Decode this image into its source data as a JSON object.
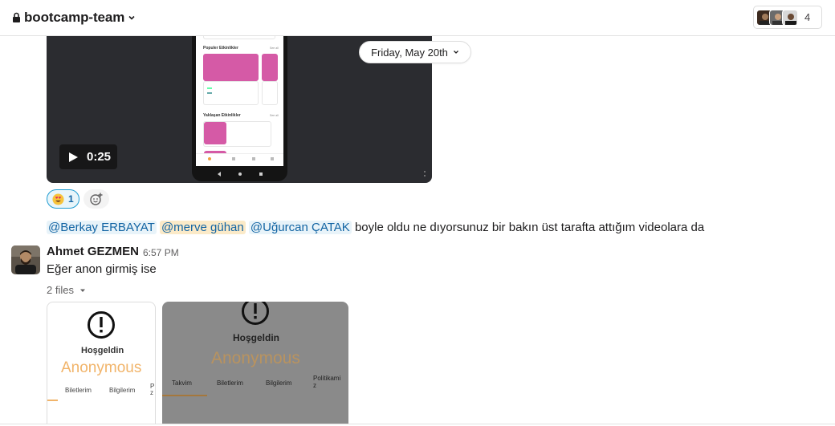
{
  "header": {
    "channel_name": "bootcamp-team",
    "member_count": "4"
  },
  "date_divider": {
    "label": "Friday, May 20th"
  },
  "video": {
    "duration": "0:25",
    "phone_screen": {
      "section1": "Populer Etkinlikler",
      "section1_link": "See all",
      "section2": "Yaklaşan Etkinlikler",
      "section2_link": "See all"
    }
  },
  "reactions": [
    {
      "emoji": "heart-eyes",
      "count": "1"
    }
  ],
  "message1": {
    "mentions": [
      "@Berkay ERBAYAT",
      "@merve gühan",
      "@Uğurcan ÇATAK"
    ],
    "text": "boyle oldu ne dıyorsunuz bir bakın üst tarafta attığım videolara da"
  },
  "message2": {
    "author": "Ahmet GEZMEN",
    "time": "6:57 PM",
    "text": "Eğer anon girmiş ise",
    "files_label": "2 files"
  },
  "attachment1": {
    "greeting": "Hoşgeldin",
    "name": "Anonymous",
    "tabs": [
      "Biletlerim",
      "Bilgilerim",
      "P z"
    ]
  },
  "attachment2": {
    "greeting": "Hoşgeldin",
    "name": "Anonymous",
    "tabs": [
      "Takvim",
      "Biletlerim",
      "Bilgilerim",
      "Politikami z"
    ]
  },
  "colors": {
    "mention_text": "#1264a3",
    "mention_bg": "#e8f3f9",
    "self_mention_bg": "#fbeac8",
    "anon_orange": "#f1b46a",
    "pink": "#d55aa6"
  }
}
